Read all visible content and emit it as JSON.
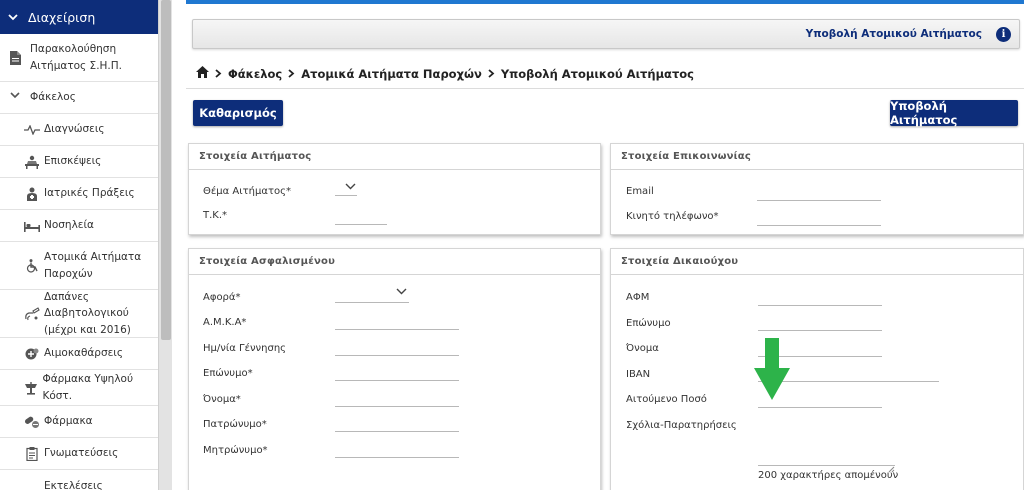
{
  "sidebar": {
    "header": "Διαχείριση",
    "items": [
      {
        "label": "Παρακολούθηση Αιτήματος Σ.Η.Π.",
        "icon": "document-icon"
      },
      {
        "label": "Φάκελος",
        "icon": "chevron-down-icon"
      },
      {
        "label": "Διαγνώσεις",
        "icon": "pulse-icon"
      },
      {
        "label": "Επισκέψεις",
        "icon": "exam-bed-icon"
      },
      {
        "label": "Ιατρικές Πράξεις",
        "icon": "doctor-icon"
      },
      {
        "label": "Νοσηλεία",
        "icon": "hospital-bed-icon"
      },
      {
        "label": "Ατομικά Αιτήματα Παροχών",
        "icon": "wheelchair-icon"
      },
      {
        "label": "Δαπάνες Διαβητολογικού (μέχρι και 2016)",
        "icon": "diabetes-icon"
      },
      {
        "label": "Αιμοκαθάρσεις",
        "icon": "dialysis-icon"
      },
      {
        "label": "Φάρμακα Υψηλού Κόστ.",
        "icon": "high-cost-drug-icon"
      },
      {
        "label": "Φάρμακα",
        "icon": "pills-icon"
      },
      {
        "label": "Γνωματεύσεις",
        "icon": "clipboard-icon"
      },
      {
        "label": "Εκτελέσεις",
        "icon": "execution-icon"
      }
    ]
  },
  "header": {
    "title": "Υποβολή Ατομικού Αιτήματος"
  },
  "breadcrumb": {
    "items": [
      "Φάκελος",
      "Ατομικά Αιτήματα Παροχών",
      "Υποβολή Ατομικού Αιτήματος"
    ]
  },
  "buttons": {
    "clear": "Καθαρισμός",
    "submit": "Υποβολή Αιτήματος"
  },
  "request_card": {
    "title": "Στοιχεία Αιτήματος",
    "fields": [
      "Θέμα Αιτήματος*",
      "Τ.Κ.*"
    ]
  },
  "contact_card": {
    "title": "Στοιχεία Επικοινωνίας",
    "fields": [
      "Email",
      "Κινητό τηλέφωνο*"
    ]
  },
  "insured_card": {
    "title": "Στοιχεία Ασφαλισμένου",
    "fields": [
      "Αφορά*",
      "Α.Μ.Κ.Α*",
      "Ημ/νία Γέννησης",
      "Επώνυμο*",
      "Όνομα*",
      "Πατρώνυμο*",
      "Μητρώνυμο*"
    ]
  },
  "beneficiary_card": {
    "title": "Στοιχεία Δικαιούχου",
    "fields": [
      "ΑΦΜ",
      "Επώνυμο",
      "Όνομα",
      "IBAN",
      "Αιτούμενο Ποσό",
      "Σχόλια-Παρατηρήσεις"
    ],
    "counter": "200 χαρακτήρες απομένουν"
  },
  "colors": {
    "brand": "#0d2d7a",
    "accent": "#1f78d1",
    "arrow": "#2db34a"
  }
}
